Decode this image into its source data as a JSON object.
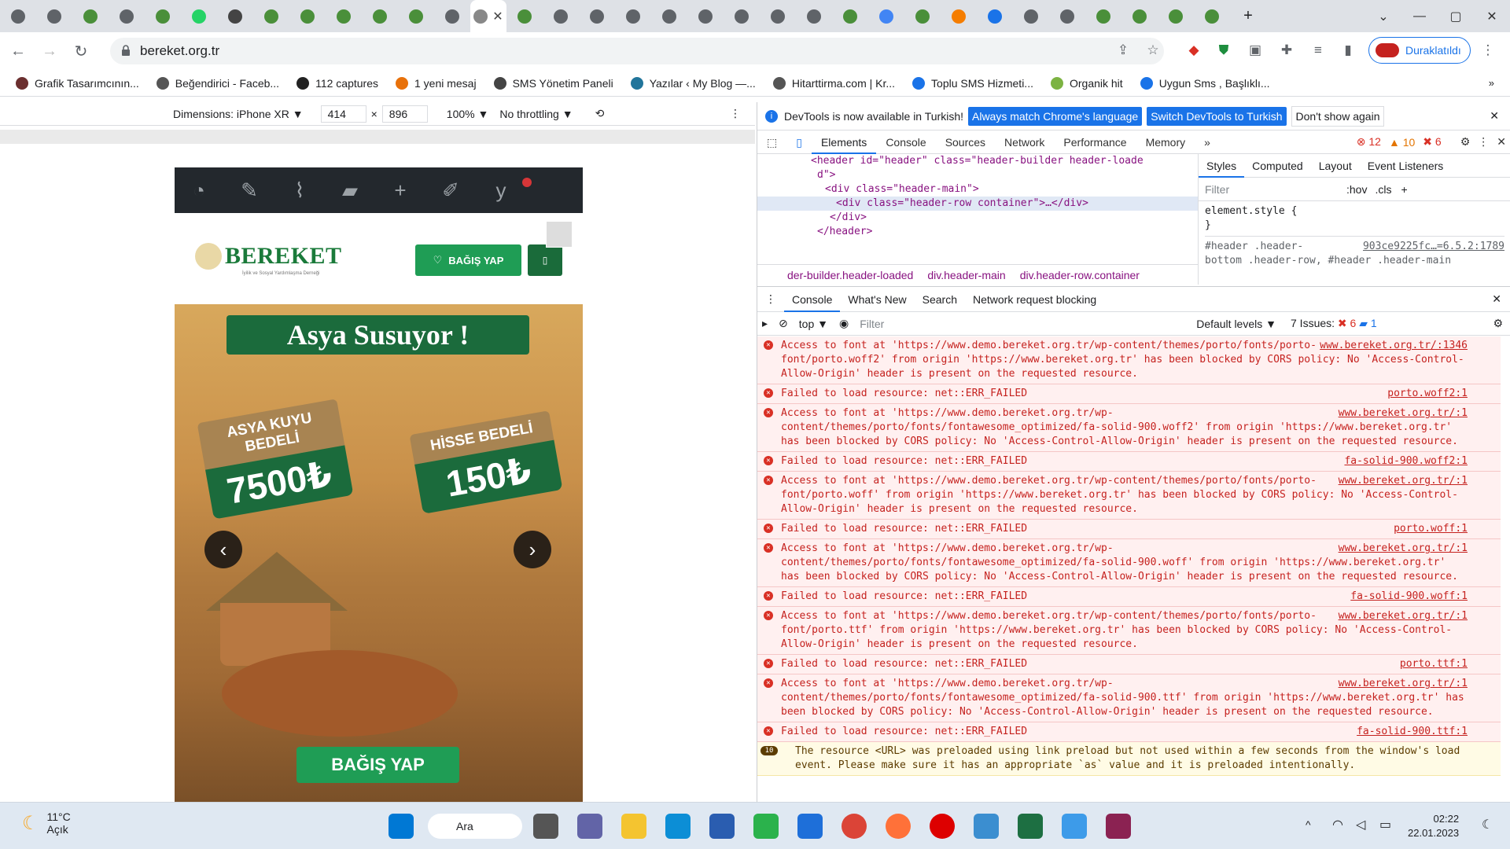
{
  "browser": {
    "tab_count_icons": [
      "chrome-tab",
      "chrome-tab",
      "site-tab",
      "chrome-tab",
      "site-tab",
      "whatsapp-tab",
      "audio-tab",
      "site-tab",
      "site-tab",
      "site-tab",
      "site-tab",
      "site-tab",
      "chrome-tab",
      "active-tab",
      "site-tab",
      "chrome-tab",
      "chrome-tab",
      "chrome-tab",
      "chrome-tab",
      "chrome-tab",
      "chrome-tab",
      "chrome-tab",
      "chrome-tab",
      "site-tab",
      "google-tab",
      "site-tab",
      "blogger-tab",
      "download-tab",
      "chrome-tab",
      "chrome-tab",
      "site-tab",
      "site-tab",
      "site-tab",
      "site-tab"
    ],
    "url": "bereket.org.tr",
    "profile_status": "Duraklatıldı"
  },
  "bookmarks": [
    {
      "label": "Grafik Tasarımcının...",
      "color": "#6b2f2f"
    },
    {
      "label": "Beğendirici - Faceb...",
      "color": "#555555"
    },
    {
      "label": "112 captures",
      "color": "#222222"
    },
    {
      "label": "1 yeni mesaj",
      "color": "#e8710a"
    },
    {
      "label": "SMS Yönetim Paneli",
      "color": "#444444"
    },
    {
      "label": "Yazılar ‹ My Blog —...",
      "color": "#21759b"
    },
    {
      "label": "Hitarttirma.com | Kr...",
      "color": "#555555"
    },
    {
      "label": "Toplu SMS Hizmeti...",
      "color": "#1a73e8"
    },
    {
      "label": "Organik hit",
      "color": "#7cb342"
    },
    {
      "label": "Uygun Sms , Başlıklı...",
      "color": "#1a73e8"
    }
  ],
  "device": {
    "dimensions_label": "Dimensions: iPhone XR ▼",
    "width": "414",
    "height": "896",
    "zoom": "100% ▼",
    "throttle": "No throttling ▼"
  },
  "site": {
    "logo_text": "BEREKET",
    "logo_sub": "İyilik ve Sosyal Yardımlaşma Derneği",
    "donate_label": "BAĞIŞ YAP",
    "banner_title": "Asya Susuyor !",
    "badge1_top": "ASYA KUYU BEDELİ",
    "badge1_price": "7500₺",
    "badge2_top": "HİSSE BEDELİ",
    "badge2_price": "150₺",
    "banner_cta": "BAĞIŞ YAP"
  },
  "devtools": {
    "info": "DevTools is now available in Turkish!",
    "btn_match": "Always match Chrome's language",
    "btn_switch": "Switch DevTools to Turkish",
    "btn_dont": "Don't show again",
    "tabs": [
      "Elements",
      "Console",
      "Sources",
      "Network",
      "Performance",
      "Memory"
    ],
    "errors": "12",
    "warnings": "10",
    "issues_count": "6",
    "elements_lines": [
      "<header id=\"header\" class=\"header-builder header-loade",
      "d\">",
      "<div class=\"header-main\">",
      "<div class=\"header-row container\">…</div>",
      "</div>",
      "</header>"
    ],
    "crumbs": [
      "der-builder.header-loaded",
      "div.header-main",
      "div.header-row.container"
    ],
    "style_tabs": [
      "Styles",
      "Computed",
      "Layout",
      "Event Listeners"
    ],
    "filter_placeholder": "Filter",
    "hov": ":hov",
    "cls": ".cls",
    "element_style": "element.style {",
    "element_style_close": "}",
    "rule_selector": "#header .header-",
    "rule_src": "903ce9225fc…=6.5.2:1789",
    "rule_selector2": "bottom .header-row, #header .header-main",
    "drawer_tabs": [
      "Console",
      "What's New",
      "Search",
      "Network request blocking"
    ],
    "context": "top ▼",
    "console_filter": "Filter",
    "levels": "Default levels ▼",
    "issues_label": "7 Issues:",
    "issues_err": "6",
    "issues_info": "1"
  },
  "console": [
    {
      "type": "err",
      "text": "Access to font at 'https://www.demo.bereket.org.tr/wp-content/themes/porto/fonts/porto-font/porto.woff2' from origin 'https://www.bereket.org.tr' has been blocked by CORS policy: No 'Access-Control-Allow-Origin' header is present on the requested resource.",
      "src": "www.bereket.org.tr/:1346"
    },
    {
      "type": "err",
      "text": "Failed to load resource: net::ERR_FAILED",
      "src": "porto.woff2:1"
    },
    {
      "type": "err",
      "text": "Access to font at 'https://www.demo.bereket.org.tr/wp-content/themes/porto/fonts/fontawesome_optimized/fa-solid-900.woff2' from origin 'https://www.bereket.org.tr' has been blocked by CORS policy: No 'Access-Control-Allow-Origin' header is present on the requested resource.",
      "src": "www.bereket.org.tr/:1"
    },
    {
      "type": "err",
      "text": "Failed to load resource: net::ERR_FAILED",
      "src": "fa-solid-900.woff2:1"
    },
    {
      "type": "err",
      "text": "Access to font at 'https://www.demo.bereket.org.tr/wp-content/themes/porto/fonts/porto-font/porto.woff' from origin 'https://www.bereket.org.tr' has been blocked by CORS policy: No 'Access-Control-Allow-Origin' header is present on the requested resource.",
      "src": "www.bereket.org.tr/:1"
    },
    {
      "type": "err",
      "text": "Failed to load resource: net::ERR_FAILED",
      "src": "porto.woff:1"
    },
    {
      "type": "err",
      "text": "Access to font at 'https://www.demo.bereket.org.tr/wp-content/themes/porto/fonts/fontawesome_optimized/fa-solid-900.woff' from origin 'https://www.bereket.org.tr' has been blocked by CORS policy: No 'Access-Control-Allow-Origin' header is present on the requested resource.",
      "src": "www.bereket.org.tr/:1"
    },
    {
      "type": "err",
      "text": "Failed to load resource: net::ERR_FAILED",
      "src": "fa-solid-900.woff:1"
    },
    {
      "type": "err",
      "text": "Access to font at 'https://www.demo.bereket.org.tr/wp-content/themes/porto/fonts/porto-font/porto.ttf' from origin 'https://www.bereket.org.tr' has been blocked by CORS policy: No 'Access-Control-Allow-Origin' header is present on the requested resource.",
      "src": "www.bereket.org.tr/:1"
    },
    {
      "type": "err",
      "text": "Failed to load resource: net::ERR_FAILED",
      "src": "porto.ttf:1"
    },
    {
      "type": "err",
      "text": "Access to font at 'https://www.demo.bereket.org.tr/wp-content/themes/porto/fonts/fontawesome_optimized/fa-solid-900.ttf' from origin 'https://www.bereket.org.tr' has been blocked by CORS policy: No 'Access-Control-Allow-Origin' header is present on the requested resource.",
      "src": "www.bereket.org.tr/:1"
    },
    {
      "type": "err",
      "text": "Failed to load resource: net::ERR_FAILED",
      "src": "fa-solid-900.ttf:1"
    },
    {
      "type": "warn",
      "count": "10",
      "text": "The resource <URL> was preloaded using link preload but not used within a few seconds from the window's load event. Please make sure it has an appropriate `as` value and it is preloaded intentionally.",
      "src": ""
    }
  ],
  "taskbar": {
    "temp": "11°C",
    "weather": "Açık",
    "search": "Ara",
    "time": "02:22",
    "date": "22.01.2023"
  }
}
